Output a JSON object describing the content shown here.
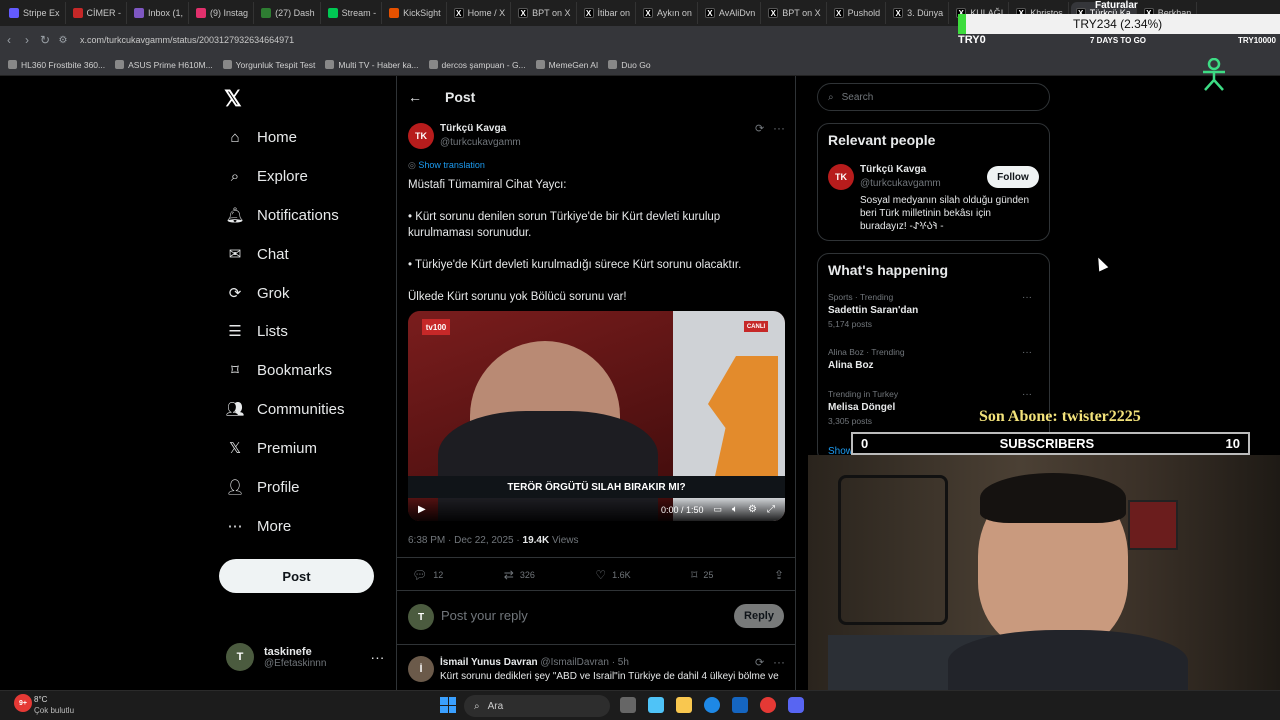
{
  "browser": {
    "tabs": [
      {
        "label": "Stripe Ex",
        "color": "#635bff"
      },
      {
        "label": "CİMER -",
        "color": "#c62828"
      },
      {
        "label": "Inbox (1,",
        "color": "#7e57c2"
      },
      {
        "label": "(9) Instag",
        "color": "#e1306c"
      },
      {
        "label": "(27) Dash",
        "color": "#2e7d32"
      },
      {
        "label": "Stream -",
        "color": "#00c853"
      },
      {
        "label": "KickSight",
        "color": "#e65100"
      },
      {
        "label": "Home / X",
        "color": "#000000"
      },
      {
        "label": "BPT on X",
        "color": "#000000"
      },
      {
        "label": "İtibar on",
        "color": "#000000"
      },
      {
        "label": "Aykın on",
        "color": "#000000"
      },
      {
        "label": "AvAliDvn",
        "color": "#000000"
      },
      {
        "label": "BPT on X",
        "color": "#000000"
      },
      {
        "label": "Pushold",
        "color": "#000000"
      },
      {
        "label": "3. Dünya",
        "color": "#000000"
      },
      {
        "label": "KULAĞI",
        "color": "#000000"
      },
      {
        "label": "Khristos",
        "color": "#000000"
      },
      {
        "label": "Türkçü Ka",
        "color": "#000000",
        "active": true
      },
      {
        "label": "Berkhan",
        "color": "#000000"
      }
    ],
    "url": "x.com/turkcukavgamm/status/2003127932634664971",
    "bookmarks": [
      "HL360 Frostbite 360...",
      "ASUS Prime H610M...",
      "Yorgunluk Tespit Test",
      "Multi TV - Haber ka...",
      "dercos şampuan - G...",
      "MemeGen AI",
      "Duo Go"
    ]
  },
  "overlay": {
    "ticker": "TRY234 (2.34%)",
    "try0": "TRY0",
    "days": "7 DAYS TO GO",
    "faturalar": "Faturalar",
    "ext_amount": "TRY10000",
    "son_abone": "Son Abone: twister2225",
    "subs_left": "0",
    "subs_label": "SUBSCRIBERS",
    "subs_right": "10"
  },
  "sidebar": {
    "items": [
      {
        "label": "Home",
        "icon": "home-icon"
      },
      {
        "label": "Explore",
        "icon": "search-icon"
      },
      {
        "label": "Notifications",
        "icon": "bell-icon"
      },
      {
        "label": "Chat",
        "icon": "mail-icon"
      },
      {
        "label": "Grok",
        "icon": "grok-icon"
      },
      {
        "label": "Lists",
        "icon": "list-icon"
      },
      {
        "label": "Bookmarks",
        "icon": "bookmark-icon"
      },
      {
        "label": "Communities",
        "icon": "people-icon"
      },
      {
        "label": "Premium",
        "icon": "x-icon"
      },
      {
        "label": "Profile",
        "icon": "person-icon"
      },
      {
        "label": "More",
        "icon": "more-icon"
      }
    ],
    "post_button": "Post",
    "account": {
      "name": "taskinefe",
      "handle": "@Efetaskinnn"
    }
  },
  "post": {
    "header": "Post",
    "author": "Türkçü Kavga",
    "handle": "@turkcukavgamm",
    "show_translation": "Show translation",
    "lines": [
      "Müstafi Tümamiral Cihat Yaycı:",
      "• Kürt sorunu denilen sorun Türkiye'de bir Kürt devleti kurulup kurulmaması sorunudur.",
      "• Türkiye'de Kürt devleti kurulmadığı sürece Kürt sorunu olacaktır.",
      "Ülkede Kürt sorunu yok Bölücü sorunu var!"
    ],
    "video": {
      "caption": "TERÖR ÖRGÜTÜ SILAH BIRAKIR MI?",
      "badge": "CANLI",
      "time": "0:00 / 1:50",
      "progress": 0
    },
    "timestamp": "6:38 PM · Dec 22, 2025 ·",
    "views": "19.4K",
    "views_label": "Views",
    "replies": "12",
    "reposts": "326",
    "likes": "1.6K",
    "bookmarks": "25",
    "reply_placeholder": "Post your reply",
    "reply_button": "Reply"
  },
  "reply": {
    "author": "İsmail Yunus Davran",
    "handle": "@IsmailDavran · 5h",
    "text": "Kürt sorunu dedikleri şey \"ABD ve İsrail\"in Türkiye de dahil 4 ülkeyi bölme ve"
  },
  "right": {
    "search_placeholder": "Search",
    "relevant_title": "Relevant people",
    "person": {
      "name": "Türkçü Kavga",
      "handle": "@turkcukavgamm",
      "follow": "Follow",
      "bio": "Sosyal medyanın silah olduğu günden beri Türk milletinin bekâsı için buradayız! -𐰚𐰉𐰍𐰀 -"
    },
    "happening_title": "What's happening",
    "trends": [
      {
        "context": "Sports · Trending",
        "title": "Sadettin Saran'dan",
        "count": "5,174 posts"
      },
      {
        "context": "Alina Boz · Trending",
        "title": "Alina Boz",
        "count": ""
      },
      {
        "context": "Trending in Turkey",
        "title": "Melisa Döngel",
        "count": "3,305 posts"
      }
    ],
    "show_more": "Show more"
  },
  "taskbar": {
    "temp": "8°C",
    "weather": "Çok bulutlu",
    "search": "Ara",
    "badge": "9+"
  }
}
